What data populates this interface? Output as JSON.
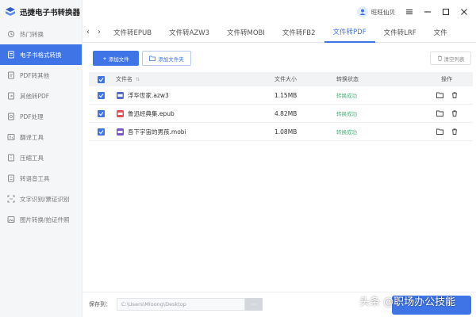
{
  "app": {
    "title": "迅捷电子书转换器"
  },
  "user": {
    "name": "旺旺仙贝"
  },
  "sidebar": {
    "items": [
      {
        "label": "热门转换",
        "icon": "flame-icon",
        "active": false
      },
      {
        "label": "电子书格式转换",
        "icon": "book-icon",
        "active": true
      },
      {
        "label": "PDF转其他",
        "icon": "pdf-icon",
        "active": false
      },
      {
        "label": "其他转PDF",
        "icon": "file-convert-icon",
        "active": false
      },
      {
        "label": "PDF处理",
        "icon": "pdf-tool-icon",
        "active": false
      },
      {
        "label": "翻译工具",
        "icon": "translate-icon",
        "active": false
      },
      {
        "label": "压缩工具",
        "icon": "compress-icon",
        "active": false
      },
      {
        "label": "转语音工具",
        "icon": "speech-icon",
        "active": false
      },
      {
        "label": "文字识别/票证识别",
        "icon": "ocr-icon",
        "active": false
      },
      {
        "label": "图片转换/拍证件照",
        "icon": "image-icon",
        "active": false
      }
    ]
  },
  "tabs": [
    {
      "label": "文件转EPUB",
      "active": false
    },
    {
      "label": "文件转AZW3",
      "active": false
    },
    {
      "label": "文件转MOBI",
      "active": false
    },
    {
      "label": "文件转FB2",
      "active": false
    },
    {
      "label": "文件转PDF",
      "active": true
    },
    {
      "label": "文件转LRF",
      "active": false
    },
    {
      "label": "文件",
      "active": false
    }
  ],
  "toolbar": {
    "add_file": "添加文件",
    "add_folder": "添加文件夹",
    "clear_list": "清空列表"
  },
  "table": {
    "headers": {
      "name": "文件名",
      "size": "文件大小",
      "status": "转换状态",
      "action": "操作"
    },
    "rows": [
      {
        "name": "浮华世家.azw3",
        "size": "1.15MB",
        "status": "转换成功",
        "icon_color": "#5a6fc9"
      },
      {
        "name": "鲁迅经典集.epub",
        "size": "4.82MB",
        "status": "转换成功",
        "icon_color": "#e05252"
      },
      {
        "name": "吾下宇宙的男孩.mobi",
        "size": "1.08MB",
        "status": "转换成功",
        "icon_color": "#7a56c9"
      }
    ]
  },
  "footer": {
    "save_label": "保存到：",
    "save_path": "C:\\Users\\Mloong\\Desktop",
    "more": "···"
  },
  "watermark": "头条 @职场办公技能",
  "colors": {
    "accent": "#3e74e6",
    "success": "#3fb67a"
  }
}
